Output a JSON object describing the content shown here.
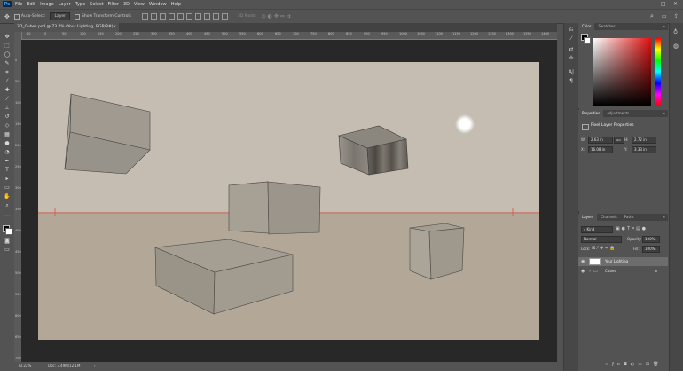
{
  "app": {
    "logo": "Ps"
  },
  "menu": [
    "File",
    "Edit",
    "Image",
    "Layer",
    "Type",
    "Select",
    "Filter",
    "3D",
    "View",
    "Window",
    "Help"
  ],
  "window_controls": {
    "minimize": "–",
    "maximize": "□",
    "close": "✕"
  },
  "options": {
    "auto_select_label": "Auto-Select:",
    "auto_select_target": "Layer",
    "show_transform_label": "Show Transform Controls",
    "mode_label": "3D Mode:"
  },
  "document_tab": {
    "title": "3D_Cubes.psd @ 73.2% (Your Lighting, RGB/8#)",
    "close": "×"
  },
  "ruler_h_labels": [
    "40",
    "0",
    "50",
    "100",
    "150",
    "200",
    "250",
    "300",
    "350",
    "400",
    "450",
    "500",
    "550",
    "600",
    "650",
    "700",
    "750",
    "800",
    "850",
    "900",
    "950",
    "1000",
    "1050",
    "1100",
    "1150",
    "1200",
    "1250",
    "1300",
    "1350",
    "1400"
  ],
  "ruler_v_labels": [
    "0",
    "50",
    "100",
    "150",
    "200",
    "250",
    "300",
    "350",
    "400",
    "450",
    "500",
    "550",
    "600",
    "650",
    "700"
  ],
  "status": {
    "zoom": "73.22%",
    "doc": "Doc: 3.49M/12.1M",
    "arrow": "›"
  },
  "color_panel": {
    "tabs": [
      "Color",
      "Swatches"
    ],
    "menu": "≡"
  },
  "properties_panel": {
    "tabs": [
      "Properties",
      "Adjustments"
    ],
    "title": "Pixel Layer Properties",
    "w_label": "W:",
    "w": "2.63 in",
    "h_label": "H:",
    "h": "2.72 in",
    "x_label": "X:",
    "x": "16.08 in",
    "y_label": "Y:",
    "y": "3.33 in",
    "link": "GO"
  },
  "layers_panel": {
    "tabs": [
      "Layers",
      "Channels",
      "Paths"
    ],
    "kind": "Kind",
    "blend": "Normal",
    "opacity_label": "Opacity:",
    "opacity": "100%",
    "lock_label": "Lock:",
    "fill_label": "Fill:",
    "fill": "100%",
    "layers": [
      {
        "name": "Your Lighting",
        "selected": true
      },
      {
        "name": "Cubes",
        "selected": false
      }
    ]
  },
  "colors": {
    "accent": "#31a8ff",
    "guide": "#e0504a",
    "canvas_wall": "#c5bdb2",
    "canvas_floor": "#b3a898"
  }
}
